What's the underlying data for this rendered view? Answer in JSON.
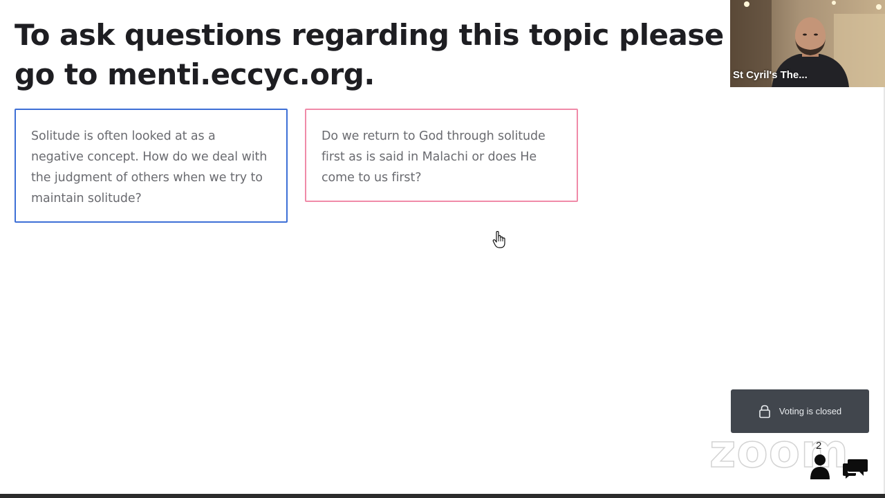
{
  "slide": {
    "heading": "To ask questions regarding this topic please go to menti.eccyc.org."
  },
  "questions": [
    {
      "text": "Solitude is often looked at as a negative concept. How do we deal with the judgment of others when we try to maintain solitude?"
    },
    {
      "text": "Do we return to God through solitude first as is said in Malachi or does He come to us first?"
    }
  ],
  "video": {
    "participant_name": "St Cyril's The..."
  },
  "voting": {
    "status_label": "Voting is closed",
    "icon": "lock-icon"
  },
  "branding": {
    "logo_text": "zoom"
  },
  "audience": {
    "count": "2",
    "icon": "person-icon"
  },
  "chat": {
    "icon": "chat-icon"
  },
  "colors": {
    "card_blue_border": "#3d6fd6",
    "card_pink_border": "#f08aa8",
    "heading_text": "#1e1e22",
    "voting_bg": "#41464d"
  }
}
